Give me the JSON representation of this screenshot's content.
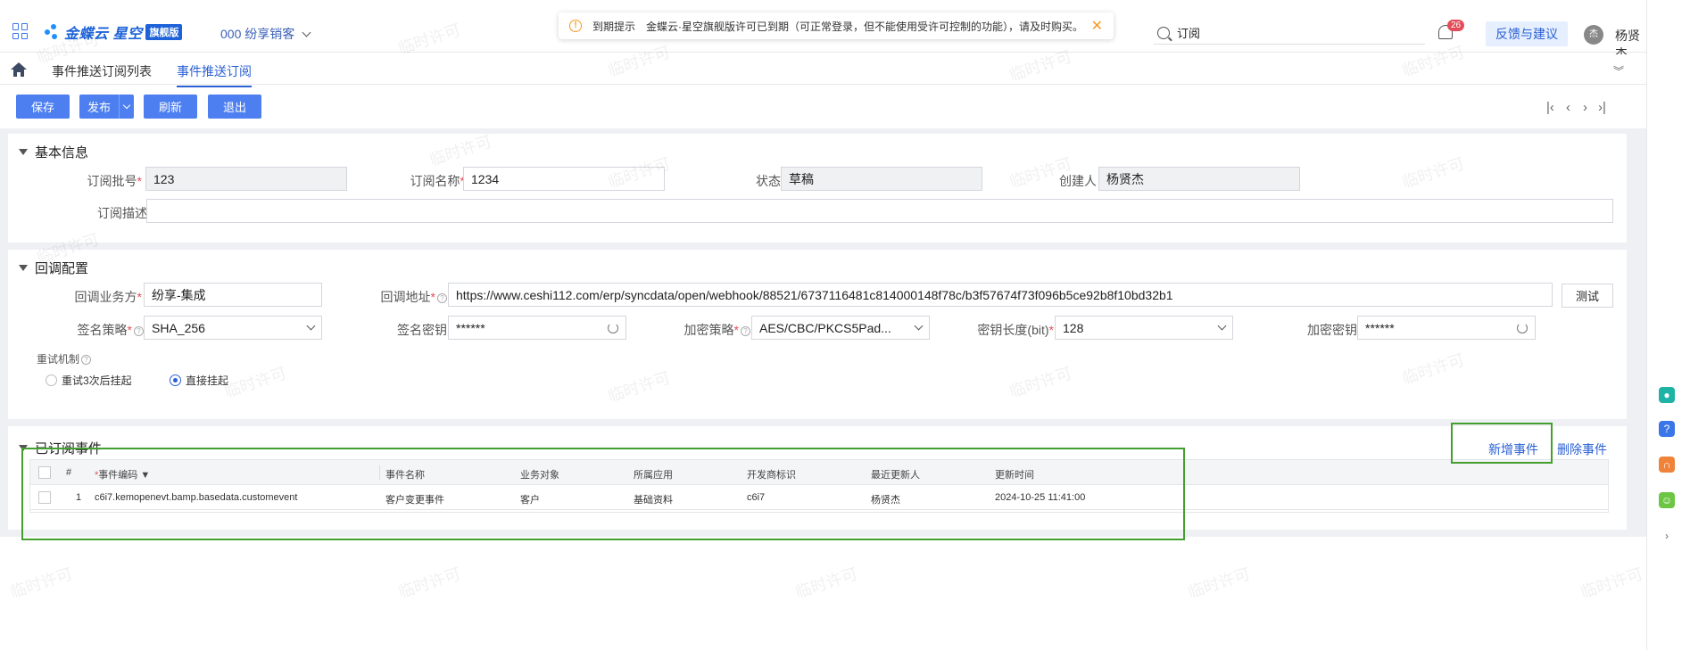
{
  "topbar": {
    "brand": "金蝶云 星空",
    "edition": "旗舰版",
    "tenant": "000 纷享销客",
    "notice": {
      "title": "到期提示",
      "message": "金蝶云·星空旗舰版许可已到期（可正常登录，但不能使用受许可控制的功能），请及时购买。"
    },
    "search_value": "订阅",
    "notifications": "26",
    "feedback": "反馈与建议",
    "avatar_initial": "杰",
    "user": "杨贤杰"
  },
  "tabs": [
    {
      "label": "事件推送订阅列表"
    },
    {
      "label": "事件推送订阅"
    }
  ],
  "toolbar": {
    "save": "保存",
    "publish": "发布",
    "refresh": "刷新",
    "exit": "退出"
  },
  "pager": {
    "first": "|‹",
    "prev": "‹",
    "next": "›",
    "last": "›|"
  },
  "basic": {
    "title": "基本信息",
    "batch_label": "订阅批号",
    "batch": "123",
    "name_label": "订阅名称",
    "name": "1234",
    "status_label": "状态",
    "status": "草稿",
    "creator_label": "创建人",
    "creator": "杨贤杰",
    "desc_label": "订阅描述",
    "desc": ""
  },
  "callback": {
    "title": "回调配置",
    "party_label": "回调业务方",
    "party": "纷享-集成",
    "url_label": "回调地址",
    "url": "https://www.ceshi112.com/erp/syncdata/open/webhook/88521/6737116481c814000148f78c/b3f57674f73f096b5ce92b8f10bd32b1",
    "test": "测试",
    "sign_label": "签名策略",
    "sign": "SHA_256",
    "sign_key_label": "签名密钥",
    "sign_key": "******",
    "enc_label": "加密策略",
    "enc": "AES/CBC/PKCS5Pad...",
    "key_len_label": "密钥长度(bit)",
    "key_len": "128",
    "enc_key_label": "加密密钥",
    "enc_key": "******",
    "retry_label": "重试机制",
    "retry_opt1": "重试3次后挂起",
    "retry_opt2": "直接挂起"
  },
  "events": {
    "title": "已订阅事件",
    "add": "新增事件",
    "delete": "删除事件",
    "columns": [
      "#",
      "事件编码",
      "事件名称",
      "业务对象",
      "所属应用",
      "开发商标识",
      "最近更新人",
      "更新时间"
    ],
    "rows": [
      [
        "1",
        "c6i7.kemopenevt.bamp.basedata.customevent",
        "客户变更事件",
        "客户",
        "基础资料",
        "c6i7",
        "杨贤杰",
        "2024-10-25 11:41:00"
      ]
    ]
  },
  "watermark": "临时许可",
  "colors": {
    "primary": "#4d7ff0",
    "link": "#2a60d4",
    "highlight": "#44a02e",
    "required": "#e34d59"
  }
}
